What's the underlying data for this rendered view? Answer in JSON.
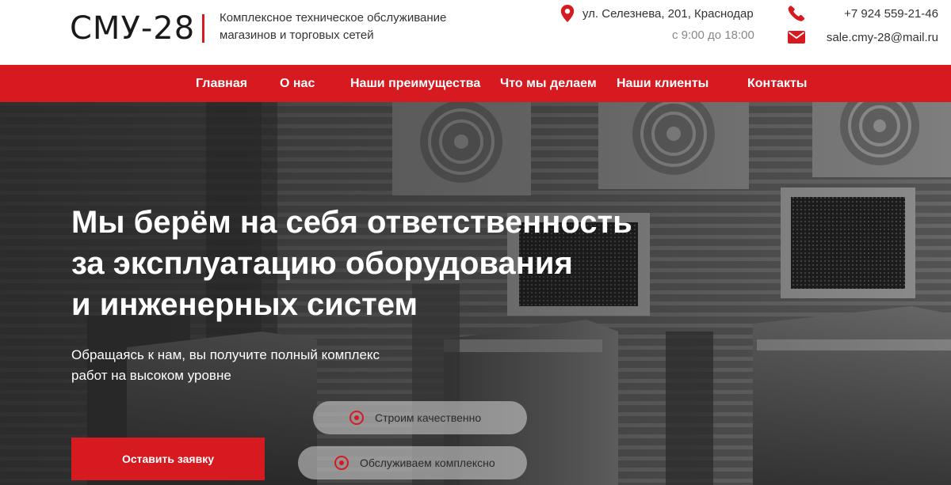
{
  "header": {
    "logo": "СМУ-28",
    "tagline": [
      "Комплексное техническое обслуживание",
      "магазинов и торговых сетей"
    ],
    "address": "ул. Селезнева, 201, Краснодар",
    "hours": "с 9:00 до 18:00",
    "phone": "+7 924 559-21-46",
    "email": "sale.cmy-28@mail.ru",
    "icons": {
      "address": "map-pin-icon",
      "phone": "phone-icon",
      "email": "envelope-icon"
    }
  },
  "nav": {
    "items": [
      {
        "label": "Главная"
      },
      {
        "label": "О нас"
      },
      {
        "label": "Наши преимущества"
      },
      {
        "label": "Что мы делаем"
      },
      {
        "label": "Наши клиенты"
      },
      {
        "label": "Контакты"
      }
    ]
  },
  "hero": {
    "title_lines": [
      "Мы берём на себя ответственность",
      "за эксплуатацию оборудования",
      "и инженерных систем"
    ],
    "subtitle_lines": [
      "Обращаясь к нам, вы получите полный комплекс",
      "работ на высоком уровне"
    ],
    "cta_label": "Оставить заявку",
    "features": [
      {
        "label": "Строим качественно"
      },
      {
        "label": "Обслуживаем комплексно"
      }
    ]
  },
  "colors": {
    "accent": "#d71920",
    "header_bg": "#ffffff",
    "pill_bg": "#c8c8c8",
    "hero_bg": "#5c5c5c"
  }
}
